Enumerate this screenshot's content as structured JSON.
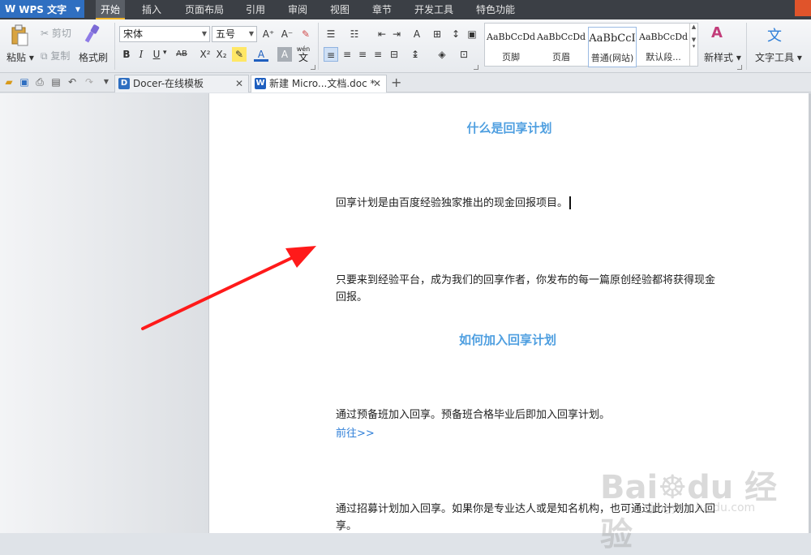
{
  "app": {
    "logo": "W",
    "title": "WPS 文字",
    "accent": "#2f6fc1"
  },
  "menu": [
    {
      "label": "开始",
      "active": true
    },
    {
      "label": "插入"
    },
    {
      "label": "页面布局"
    },
    {
      "label": "引用"
    },
    {
      "label": "审阅"
    },
    {
      "label": "视图"
    },
    {
      "label": "章节"
    },
    {
      "label": "开发工具"
    },
    {
      "label": "特色功能"
    }
  ],
  "ribbon": {
    "paste": "粘贴",
    "cut": "剪切",
    "copy": "复制",
    "format_painter": "格式刷",
    "font_name": "宋体",
    "font_size": "五号",
    "bold": "B",
    "italic": "I",
    "underline": "U",
    "strikethrough": "AB",
    "superscript": "X²",
    "subscript": "X₂",
    "font_color": "A",
    "char_shading": "A",
    "phonetic": "wén",
    "phonetic_char": "文",
    "grow_font": "A⁺",
    "shrink_font": "A⁻",
    "styles": [
      {
        "preview": "AaBbCcDd",
        "name": "页脚"
      },
      {
        "preview": "AaBbCcDd",
        "name": "页眉"
      },
      {
        "preview": "AaBbCcI",
        "name": "普通(网站)",
        "selected": true
      },
      {
        "preview": "AaBbCcDd",
        "name": "默认段..."
      }
    ],
    "new_style": "新样式",
    "text_tools": "文字工具"
  },
  "tabs": [
    {
      "label": "Docer-在线模板",
      "icon": "D"
    },
    {
      "label": "新建 Micro...文档.doc *",
      "icon": "W",
      "active": true
    }
  ],
  "document": {
    "heading1": "什么是回享计划",
    "p1": "回享计划是由百度经验独家推出的现金回报项目。",
    "p2": "只要来到经验平台，成为我们的回享作者，你发布的每一篇原创经验都将获得现金回报。",
    "heading2": "如何加入回享计划",
    "p3": "通过预备班加入回享。预备班合格毕业后即加入回享计划。",
    "link": "前往>>",
    "p4": "通过招募计划加入回享。如果你是专业达人或是知名机构，也可通过此计划加入回享。"
  },
  "watermark": {
    "brand": "Bai",
    "brand2": "du",
    "brand3": "经验",
    "url": "jingyan.baidu.com"
  },
  "colors": {
    "heading": "#4f9fe0",
    "link": "#2f7fd8",
    "arrow": "#ff1a1a",
    "menubar": "#3b3f45"
  }
}
